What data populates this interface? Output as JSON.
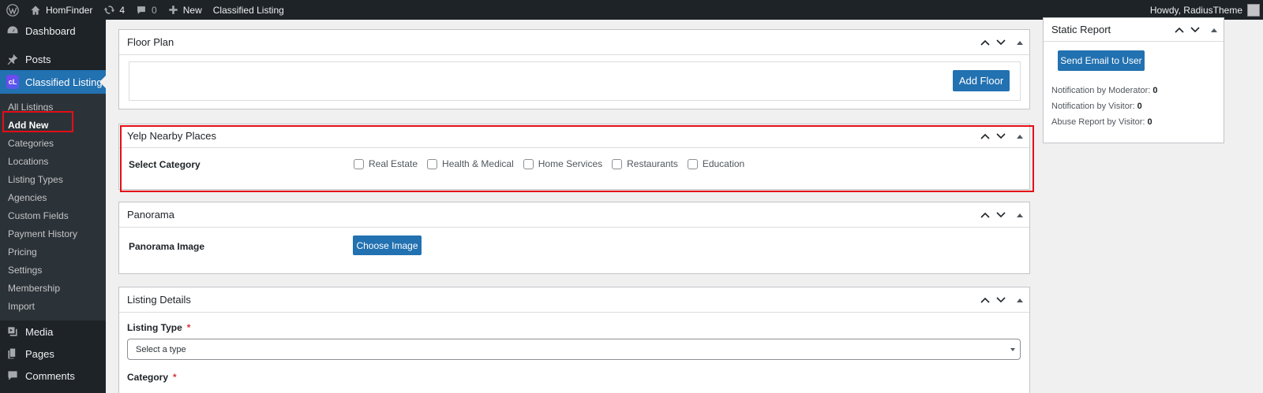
{
  "adminbar": {
    "site_name": "HomFinder",
    "updates_count": "4",
    "comments_count": "0",
    "new_label": "New",
    "classified_label": "Classified Listing",
    "howdy": "Howdy, RadiusTheme"
  },
  "sidebar": {
    "dashboard": "Dashboard",
    "posts": "Posts",
    "classified_listing": "Classified Listing",
    "cl_badge": "cL",
    "submenu": [
      "All Listings",
      "Add New",
      "Categories",
      "Locations",
      "Listing Types",
      "Agencies",
      "Custom Fields",
      "Payment History",
      "Pricing",
      "Settings",
      "Membership",
      "Import"
    ],
    "media": "Media",
    "pages": "Pages",
    "comments": "Comments"
  },
  "floor_plan": {
    "title": "Floor Plan",
    "add_button": "Add Floor"
  },
  "yelp": {
    "title": "Yelp Nearby Places",
    "label": "Select Category",
    "options": [
      "Real Estate",
      "Health & Medical",
      "Home Services",
      "Restaurants",
      "Education"
    ]
  },
  "panorama": {
    "title": "Panorama",
    "label": "Panorama Image",
    "button": "Choose Image"
  },
  "listing_details": {
    "title": "Listing Details",
    "type_label": "Listing Type",
    "type_placeholder": "Select a type",
    "category_label": "Category",
    "required_mark": "*"
  },
  "static_report": {
    "title": "Static Report",
    "button": "Send Email to User",
    "moderator_label": "Notification by Moderator:",
    "moderator_value": "0",
    "visitor_label": "Notification by Visitor:",
    "visitor_value": "0",
    "abuse_label": "Abuse Report by Visitor:",
    "abuse_value": "0"
  },
  "colors": {
    "adminbar_bg": "#1d2327",
    "primary": "#2271b1",
    "highlight": "#e40e17"
  }
}
